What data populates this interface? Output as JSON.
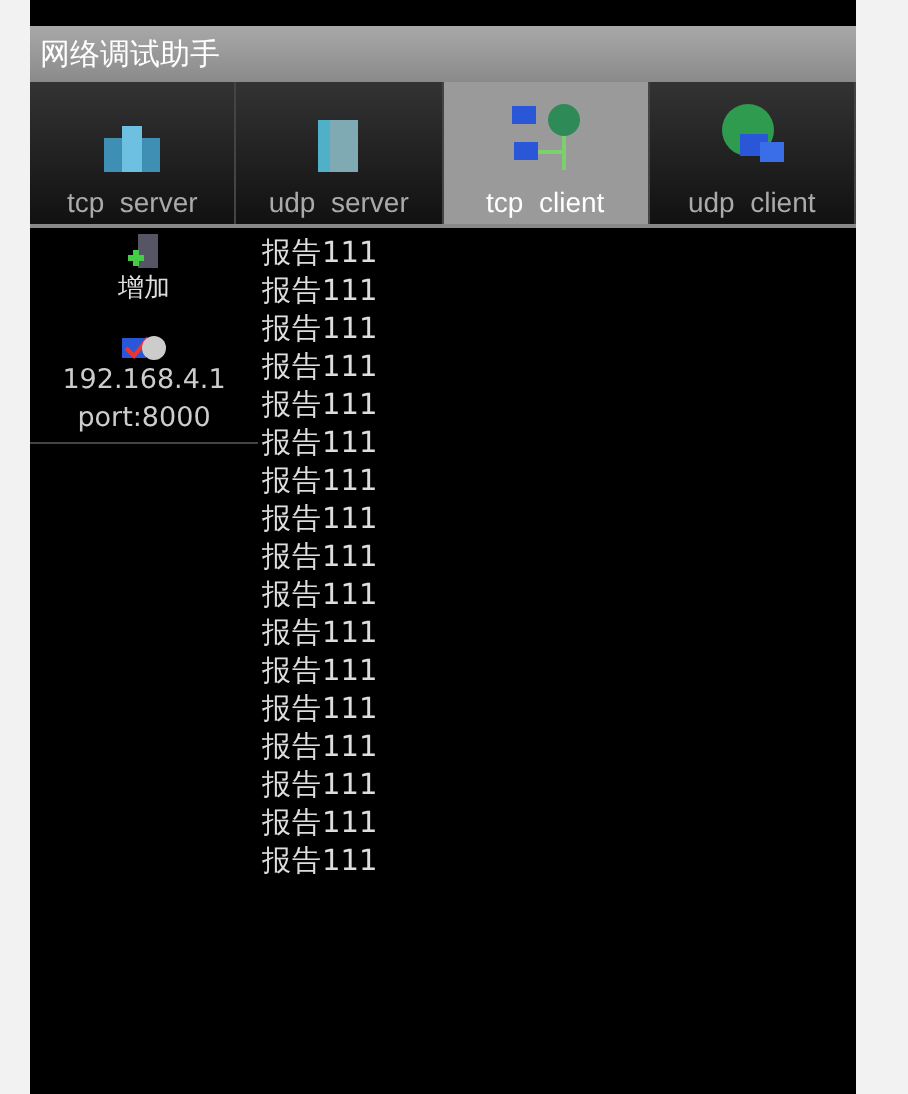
{
  "window": {
    "title": "网络调试助手"
  },
  "tabs": [
    {
      "label": "tcp  server",
      "kind": "cluster",
      "selected": false
    },
    {
      "label": "udp  server",
      "kind": "tower",
      "selected": false
    },
    {
      "label": "tcp  client",
      "kind": "network",
      "selected": true
    },
    {
      "label": "udp  client",
      "kind": "globe",
      "selected": false
    }
  ],
  "sidebar": {
    "items": [
      {
        "kind": "add",
        "label": "增加"
      },
      {
        "kind": "connection",
        "label": "192.168.4.1",
        "sublabel": "port:8000"
      }
    ]
  },
  "messages": [
    "报告111",
    "报告111",
    "报告111",
    "报告111",
    "报告111",
    "报告111",
    "报告111",
    "报告111",
    "报告111",
    "报告111",
    "报告111",
    "报告111",
    "报告111",
    "报告111",
    "报告111",
    "报告111",
    "报告111"
  ]
}
